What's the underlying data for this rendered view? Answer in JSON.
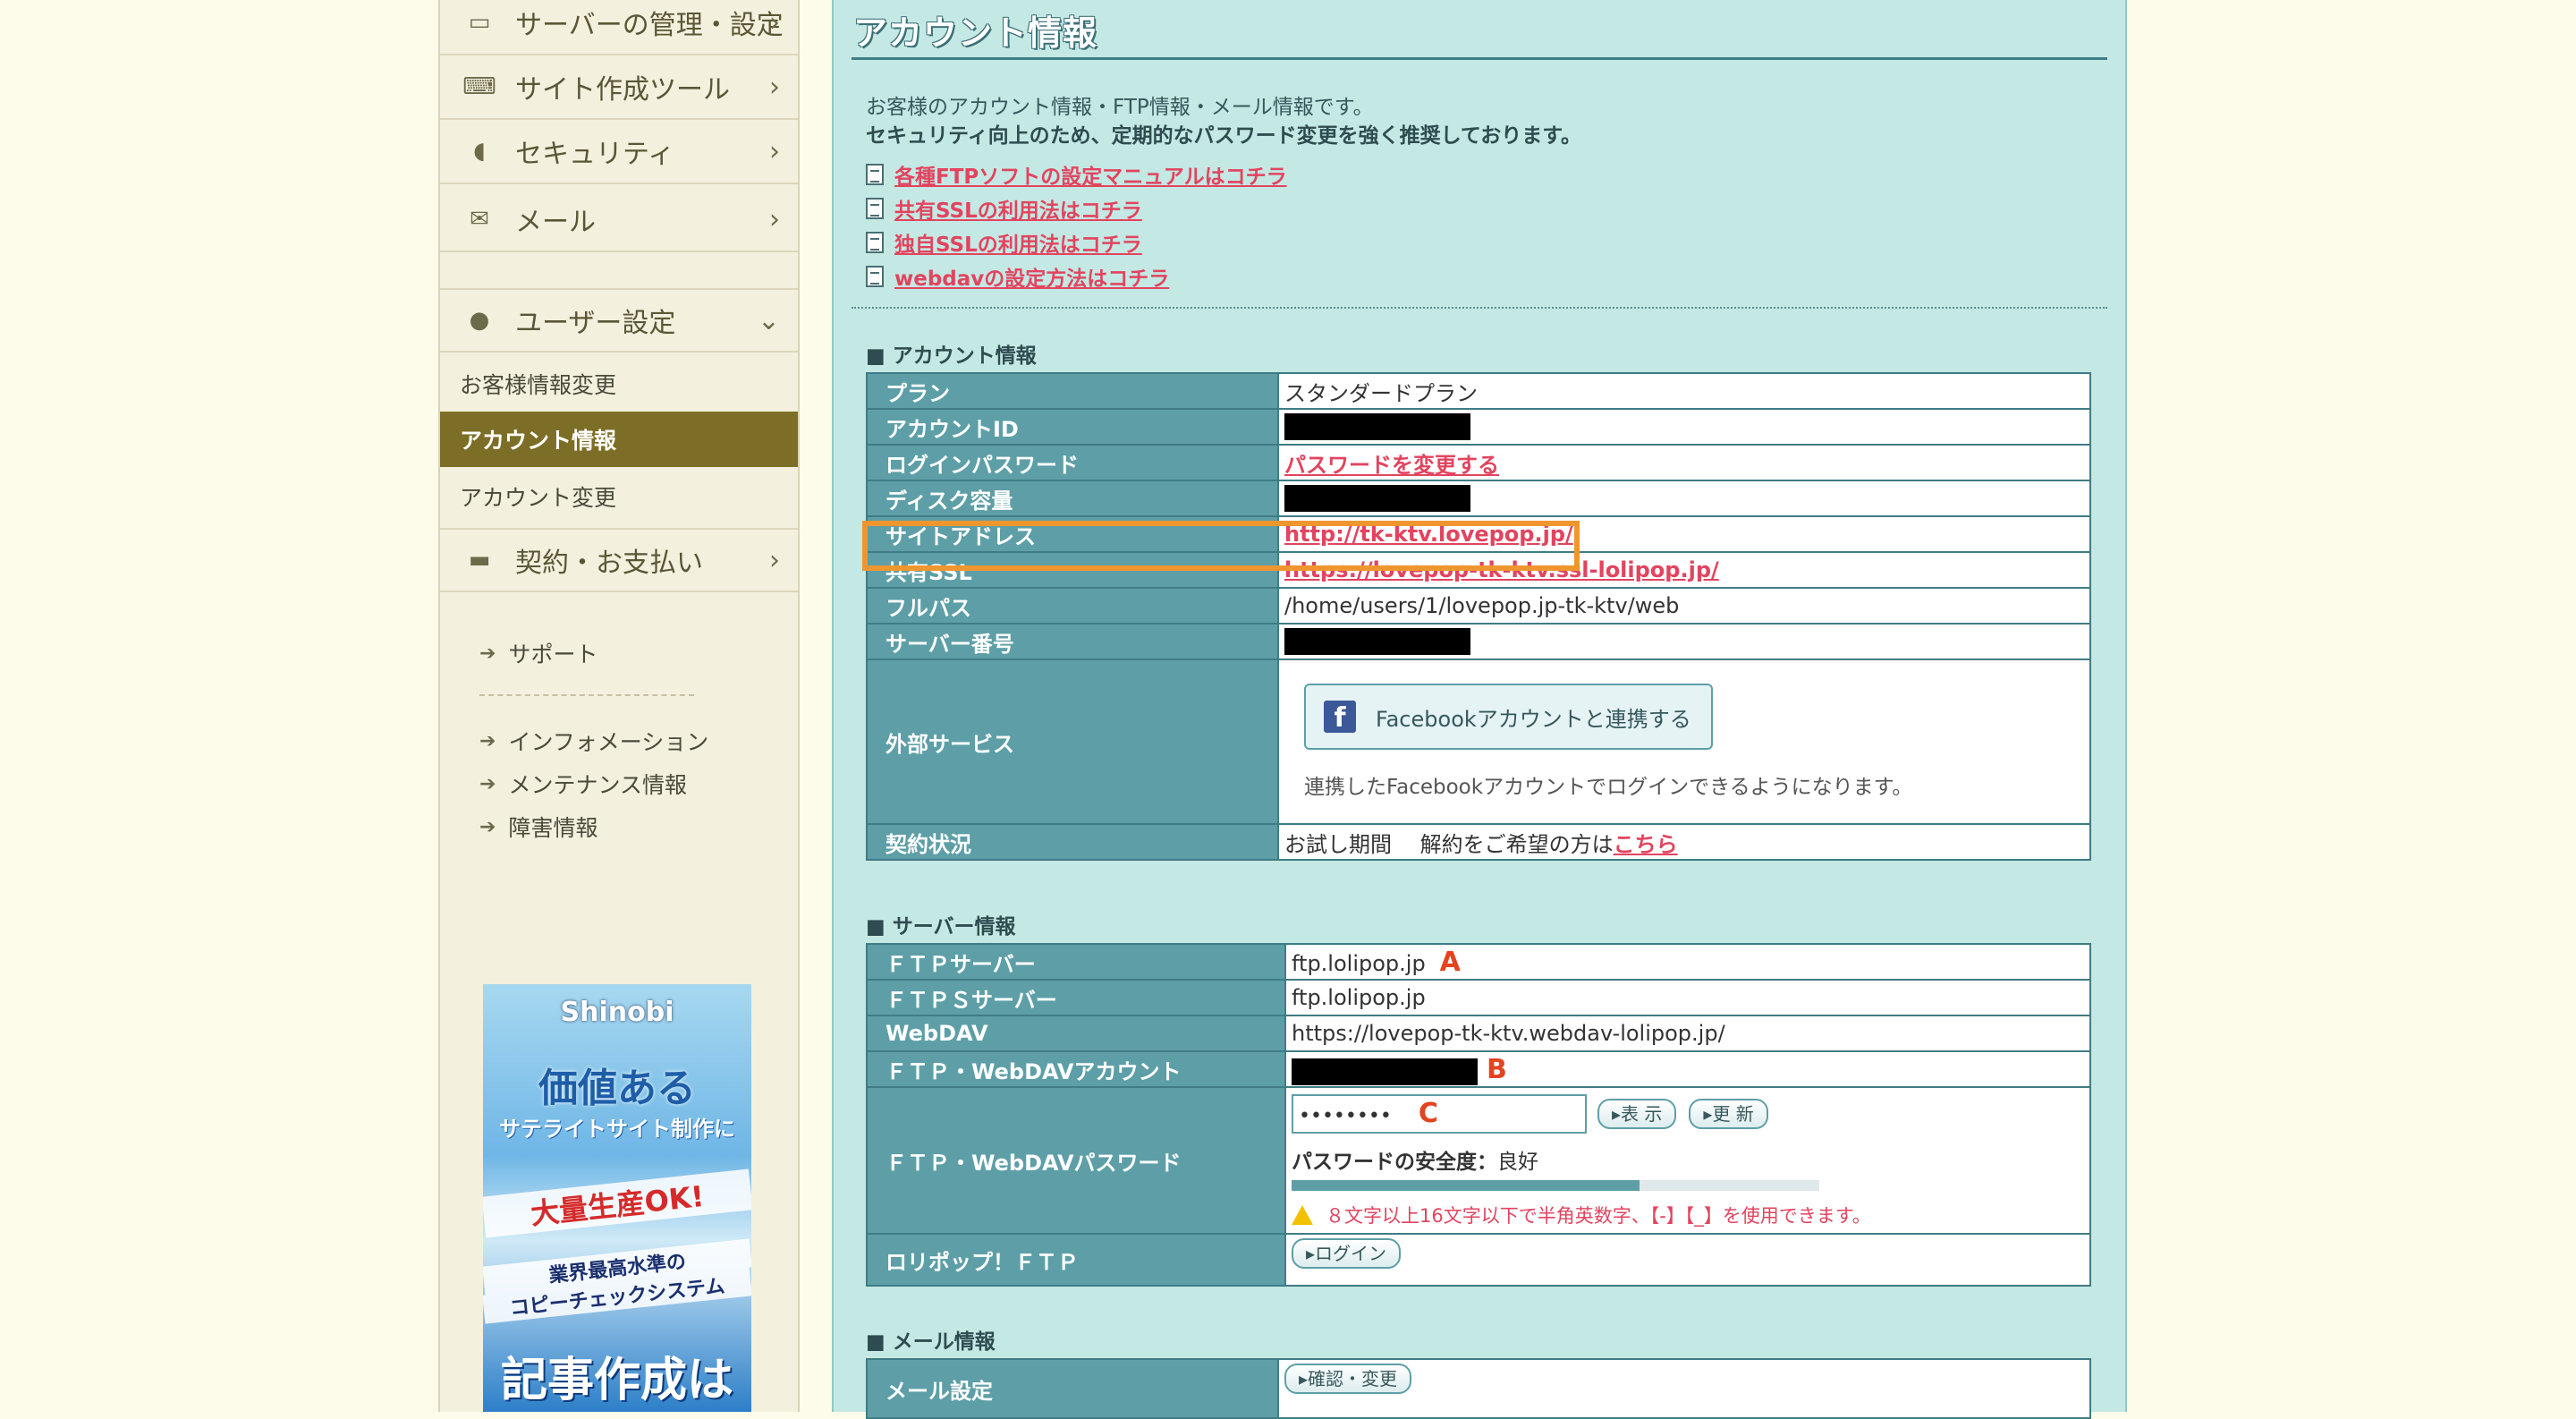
{
  "sidebar": {
    "menu": [
      {
        "label": "サーバーの管理・設定",
        "icon": "server-icon"
      },
      {
        "label": "サイト作成ツール",
        "icon": "laptop-icon"
      },
      {
        "label": "セキュリティ",
        "icon": "shield-icon"
      },
      {
        "label": "メール",
        "icon": "envelope-icon"
      }
    ],
    "user_settings": {
      "label": "ユーザー設定",
      "icon": "user-icon",
      "items": [
        "お客様情報変更",
        "アカウント情報",
        "アカウント変更"
      ]
    },
    "billing": {
      "label": "契約・お支払い",
      "icon": "credit-card-icon"
    },
    "support": [
      "サポート",
      "インフォメーション",
      "メンテナンス情報",
      "障害情報"
    ],
    "banner": {
      "brand": "Shinobi",
      "line1": "価値ある",
      "line2": "サテライトサイト制作に",
      "line3": "大量生産OK!",
      "line4": "業界最高水準の",
      "line5": "コピーチェックシステム",
      "line6": "記事作成は"
    }
  },
  "main": {
    "title": "アカウント情報",
    "intro": [
      "お客様のアカウント情報・FTP情報・メール情報です。",
      "セキュリティ向上のため、定期的なパスワード変更を強く推奨しております。"
    ],
    "links": [
      "各種FTPソフトの設定マニュアルはコチラ",
      "共有SSLの利用法はコチラ",
      "独自SSLの利用法はコチラ",
      "webdavの設定方法はコチラ"
    ],
    "account_section": {
      "heading": "■ アカウント情報",
      "plan": {
        "key": "プラン",
        "value": "スタンダードプラン"
      },
      "account_id": {
        "key": "アカウントID"
      },
      "login_password": {
        "key": "ログインパスワード",
        "value": "パスワードを変更する"
      },
      "disk": {
        "key": "ディスク容量"
      },
      "site_address": {
        "key": "サイトアドレス",
        "value": "http://tk-ktv.lovepop.jp/"
      },
      "shared_ssl": {
        "key": "共有SSL",
        "value": "https://lovepop-tk-ktv.ssl-lolipop.jp/"
      },
      "full_path": {
        "key": "フルパス",
        "value": "/home/users/1/lovepop.jp-tk-ktv/web"
      },
      "server_no": {
        "key": "サーバー番号"
      },
      "external": {
        "key": "外部サービス",
        "button": "Facebookアカウントと連携する",
        "note": "連携したFacebookアカウントでログインできるようになります。"
      },
      "contract": {
        "key": "契約状況",
        "status": "お試し期間",
        "cancel_text": "解約をご希望の方は",
        "cancel_link": "こちら"
      }
    },
    "server_section": {
      "heading": "■ サーバー情報",
      "ftp": {
        "key": "ＦＴＰサーバー",
        "value": "ftp.lolipop.jp",
        "marker": "A"
      },
      "ftps": {
        "key": "ＦＴＰＳサーバー",
        "value": "ftp.lolipop.jp"
      },
      "webdav": {
        "key": "WebDAV",
        "value": "https://lovepop-tk-ktv.webdav-lolipop.jp/"
      },
      "account": {
        "key": "ＦＴＰ・WebDAVアカウント",
        "marker": "B"
      },
      "password": {
        "key": "ＦＴＰ・WebDAVパスワード",
        "dots": "••••••••",
        "marker": "C",
        "show_btn": "表 示",
        "update_btn": "更 新",
        "strength_label": "パスワードの安全度：",
        "strength_value": "良好",
        "strength_fraction": 0.66,
        "warning": "８文字以上16文字以下で半角英数字、【-】【_】を使用できます。"
      },
      "lolipop_ftp": {
        "key": "ロリポップ！ＦＴＰ",
        "button": "ログイン"
      }
    },
    "mail_section": {
      "heading": "■ メール情報",
      "mail": {
        "key": "メール設定",
        "button": "確認・変更"
      }
    }
  },
  "colors": {
    "sidebar_active": "#7c6e26",
    "content_bg": "#c4e8e3",
    "table_key_bg": "#5e9fa7",
    "link_red": "#e2445f",
    "highlight_orange": "#f0962f",
    "marker_red": "#e2441f"
  }
}
